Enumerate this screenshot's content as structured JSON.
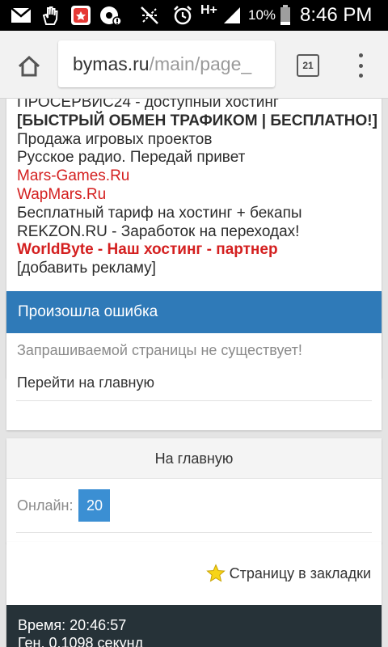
{
  "status_bar": {
    "battery_percent": "10%",
    "time": "8:46 PM",
    "network_label": "H+",
    "icons": [
      "mail-icon",
      "hand-icon",
      "app-notification-icon",
      "data-saver-icon",
      "mute-icon",
      "alarm-icon",
      "signal-icon",
      "battery-icon"
    ]
  },
  "browser": {
    "url_host": "bymas.ru",
    "url_path": "/main/page_",
    "tab_count": "21"
  },
  "ads": {
    "lines": [
      {
        "text": "ПРОСЕРВИС24 - доступный хостинг",
        "style": "normal"
      },
      {
        "text": "[БЫСТРЫЙ ОБМЕН ТРАФИКОМ | БЕСПЛАТНО!]",
        "style": "bold"
      },
      {
        "text": "Продажа игровых проектов",
        "style": "normal"
      },
      {
        "text": "Русское радио. Передай привет",
        "style": "normal"
      },
      {
        "text": "Mars-Games.Ru",
        "style": "red"
      },
      {
        "text": "WapMars.Ru",
        "style": "red"
      },
      {
        "text": "Бесплатный тариф на хостинг + бекапы",
        "style": "normal"
      },
      {
        "text": "REKZON.RU - Заработок на переходах!",
        "style": "normal"
      },
      {
        "text": "WorldByte - Наш хостинг - партнер",
        "style": "bold-red"
      },
      {
        "text": "[добавить рекламу]",
        "style": "normal"
      }
    ]
  },
  "error": {
    "title": "Произошла ошибка",
    "message": "Запрашиваемой страницы не существует!",
    "home_link": "Перейти на главную"
  },
  "nav": {
    "home_button": "На главную",
    "online_label": "Онлайн:",
    "online_count": "20"
  },
  "bookmark": {
    "label": "Страницу в закладки"
  },
  "footer": {
    "time_line": "Время: 20:46:57",
    "gen_line": "Ген. 0.1098 секунд"
  },
  "colors": {
    "accent_blue": "#2f7ab8",
    "badge_blue": "#3b8fd3",
    "link_red": "#d42020",
    "footer_bg": "#263238"
  }
}
